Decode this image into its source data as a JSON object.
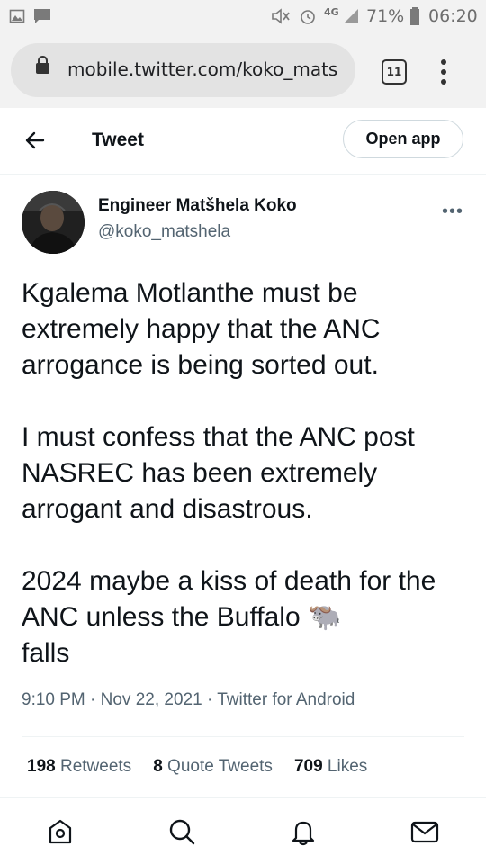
{
  "status_bar": {
    "signal_label": "4G",
    "battery": "71%",
    "time": "06:20",
    "icons": [
      "gallery-icon",
      "chat-icon",
      "mute-icon",
      "alarm-icon",
      "signal-icon",
      "battery-icon"
    ]
  },
  "browser": {
    "url": "mobile.twitter.com/koko_mats",
    "tab_count": "11"
  },
  "header": {
    "back_icon": "back-arrow-icon",
    "title": "Tweet",
    "open_app_label": "Open app"
  },
  "tweet": {
    "author_name": "Engineer Matšhela Koko",
    "author_handle": "@koko_matshela",
    "text": "Kgalema Motlanthe must be extremely happy that the ANC arrogance is being sorted out.\n\nI must confess that the ANC post NASREC has been extremely arrogant and disastrous.\n\n2024 maybe a kiss of death for the ANC unless the Buffalo 🐃\n falls",
    "timestamp": "9:10 PM · Nov 22, 2021 · Twitter for Android"
  },
  "stats": {
    "retweets_count": "198",
    "retweets_label": "Retweets",
    "quotes_count": "8",
    "quotes_label": "Quote Tweets",
    "likes_count": "709",
    "likes_label": "Likes"
  },
  "bottom_nav": [
    "home-icon",
    "search-icon",
    "notifications-icon",
    "messages-icon"
  ]
}
